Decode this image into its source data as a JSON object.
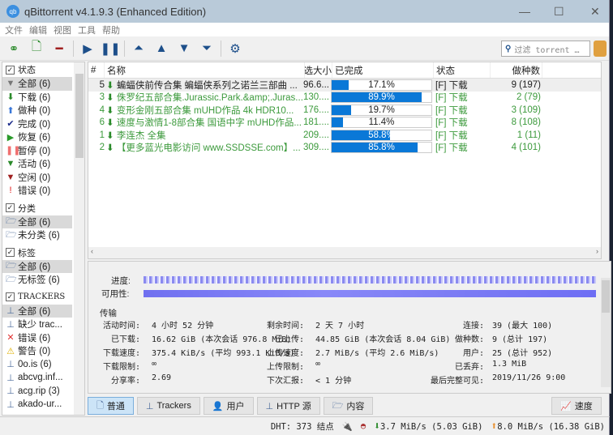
{
  "window": {
    "title": "qBittorrent v4.1.9.3 (Enhanced Edition)",
    "logo": "qb",
    "minimize": "—",
    "maximize": "☐",
    "close": "✕"
  },
  "menu": [
    "文件",
    "编辑",
    "视图",
    "工具",
    "帮助"
  ],
  "toolbar": {
    "search_placeholder": "过滤 torrent …"
  },
  "sidebar": {
    "status_header": "状态",
    "status": [
      {
        "icon": "filter-icon",
        "glyph": "▼",
        "color": "#777",
        "label": "全部 (6)"
      },
      {
        "icon": "arrow-down-icon",
        "glyph": "⬇",
        "color": "#2a8a2a",
        "label": "下载 (6)"
      },
      {
        "icon": "arrow-up-icon",
        "glyph": "⬆",
        "color": "#3a78d8",
        "label": "做种 (0)"
      },
      {
        "icon": "check-icon",
        "glyph": "✔",
        "color": "#1a2a8a",
        "label": "完成 (0)"
      },
      {
        "icon": "play-icon",
        "glyph": "▶",
        "color": "#2a9a2a",
        "label": "恢复 (6)"
      },
      {
        "icon": "pause-icon",
        "glyph": "❚❚",
        "color": "#f07070",
        "label": "暂停 (0)"
      },
      {
        "icon": "filter-icon",
        "glyph": "▼",
        "color": "#2a8a2a",
        "label": "活动 (6)"
      },
      {
        "icon": "filter-icon",
        "glyph": "▼",
        "color": "#a02020",
        "label": "空闲 (0)"
      },
      {
        "icon": "exclamation-icon",
        "glyph": "!",
        "color": "#e01010",
        "label": "错误 (0)"
      }
    ],
    "category_header": "分类",
    "categories": [
      "全部 (6)",
      "未分类 (6)"
    ],
    "tag_header": "标签",
    "tags": [
      "全部 (6)",
      "无标签 (6)"
    ],
    "tracker_header": "TRACKERS",
    "trackers": [
      {
        "icon": "tracker-icon",
        "glyph": "⊥",
        "color": "#4a6a9a",
        "label": "全部 (6)"
      },
      {
        "icon": "tracker-icon",
        "glyph": "⊥",
        "color": "#4a6a9a",
        "label": "缺少 trac..."
      },
      {
        "icon": "error-icon",
        "glyph": "✕",
        "color": "#e03030",
        "label": "错误 (6)"
      },
      {
        "icon": "warning-icon",
        "glyph": "⚠",
        "color": "#e0b000",
        "label": "警告 (0)"
      },
      {
        "icon": "tracker-icon",
        "glyph": "⊥",
        "color": "#4a6a9a",
        "label": "0o.is (6)"
      },
      {
        "icon": "tracker-icon",
        "glyph": "⊥",
        "color": "#4a6a9a",
        "label": "abcvg.inf..."
      },
      {
        "icon": "tracker-icon",
        "glyph": "⊥",
        "color": "#4a6a9a",
        "label": "acg.rip (3)"
      },
      {
        "icon": "tracker-icon",
        "glyph": "⊥",
        "color": "#4a6a9a",
        "label": "akado-ur..."
      }
    ]
  },
  "list": {
    "columns": [
      "#",
      "名称",
      "选大小",
      "已完成",
      "状态",
      "做种数"
    ],
    "rows": [
      {
        "num": "5",
        "name": "蝙蝠侠前传合集 蝙蝠侠系列之诺兰三部曲 ...",
        "size": "96.6...",
        "progress": 17.1,
        "progress_label": "17.1%",
        "status": "[F] 下载",
        "seeds": "9 (197)"
      },
      {
        "num": "3",
        "name": "侏罗纪五部合集.Jurassic.Park.&amp;.Juras...",
        "size": "130....",
        "progress": 89.9,
        "progress_label": "89.9%",
        "status": "[F] 下载",
        "seeds": "2 (79)"
      },
      {
        "num": "4",
        "name": "变形金刚五部合集 mUHD作品 4k HDR10...",
        "size": "176....",
        "progress": 19.7,
        "progress_label": "19.7%",
        "status": "[F] 下载",
        "seeds": "3 (109)"
      },
      {
        "num": "6",
        "name": "速度与激情1-8部合集 国语中字 mUHD作品...",
        "size": "181....",
        "progress": 11.4,
        "progress_label": "11.4%",
        "status": "[F] 下载",
        "seeds": "8 (108)"
      },
      {
        "num": "1",
        "name": "李连杰 全集",
        "size": "209....",
        "progress": 58.8,
        "progress_label": "58.8%",
        "status": "[F] 下载",
        "seeds": "1 (11)"
      },
      {
        "num": "2",
        "name": "【更多蓝光电影访问 www.SSDSSE.com】...",
        "size": "309....",
        "progress": 85.8,
        "progress_label": "85.8%",
        "status": "[F] 下载",
        "seeds": "4 (101)"
      }
    ]
  },
  "details": {
    "progress_label": "进度:",
    "availability_label": "可用性:",
    "transfer_header": "传输",
    "lines": [
      [
        "活动时间:",
        "4 小时 52 分钟",
        "剩余时间:",
        "2 天 7 小时",
        "连接:",
        "39 (最大 100)"
      ],
      [
        "已下载:",
        "16.62 GiB (本次会话 976.8 MiB)",
        "已上传:",
        "44.85 GiB (本次会话 8.04 GiB)",
        "做种数:",
        "9 (总计 197)"
      ],
      [
        "下载速度:",
        "375.4 KiB/s (平均 993.1 KiB/s)",
        "上传速度:",
        "2.7 MiB/s (平均 2.6 MiB/s)",
        "用户:",
        "25 (总计 952)"
      ],
      [
        "下载限制:",
        "∞",
        "上传限制:",
        "∞",
        "已丢弃:",
        "1.3 MiB"
      ],
      [
        "分享率:",
        "2.69",
        "下次汇报:",
        "< 1 分钟",
        "最后完整可见:",
        "2019/11/26 9:00"
      ]
    ]
  },
  "tabs": [
    {
      "icon": "file-icon",
      "glyph": "🗋",
      "label": "普通"
    },
    {
      "icon": "tracker-icon",
      "glyph": "⊥",
      "label": "Trackers"
    },
    {
      "icon": "users-icon",
      "glyph": "👤",
      "label": "用户"
    },
    {
      "icon": "http-icon",
      "glyph": "⊥",
      "label": "HTTP 源"
    },
    {
      "icon": "folder-icon",
      "glyph": "🗁",
      "label": "内容"
    }
  ],
  "speed_tab": "速度",
  "statusbar": {
    "dht": "DHT: 373 结点",
    "download": "3.7 MiB/s (5.03 GiB)",
    "upload": "8.0 MiB/s (16.38 GiB)"
  }
}
